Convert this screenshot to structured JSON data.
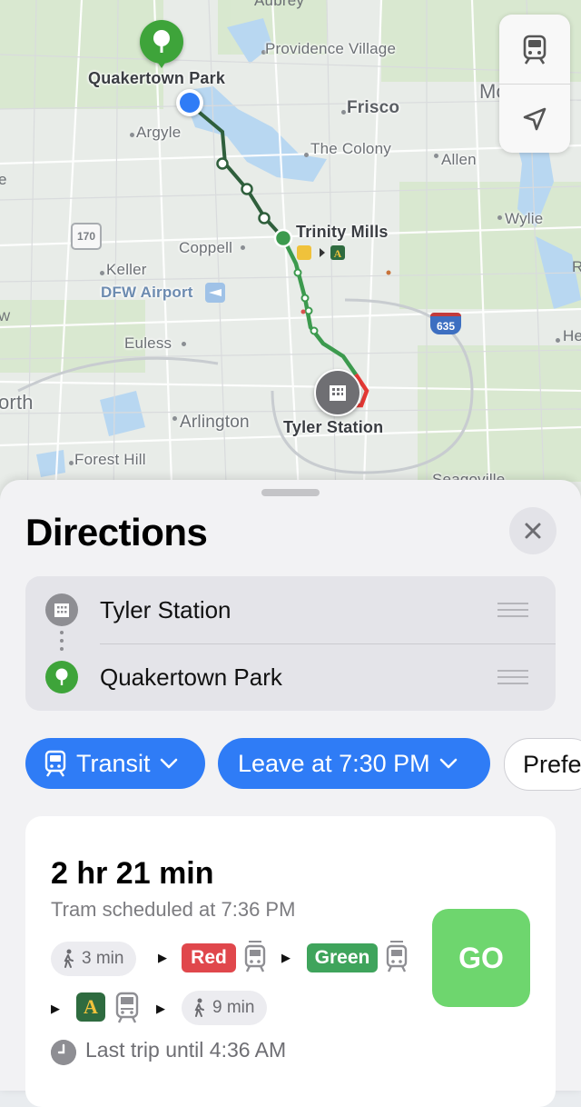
{
  "map": {
    "labels": {
      "aubrey": "Aubrey",
      "providence_village": "Providence Village",
      "quakertown_park": "Quakertown Park",
      "mckinney_partial": "Mc",
      "frisco": "Frisco",
      "argyle": "Argyle",
      "the_colony": "The Colony",
      "allen": "Allen",
      "edge_e": "e",
      "wylie": "Wylie",
      "trinity_mills": "Trinity Mills",
      "coppell": "Coppell",
      "keller": "Keller",
      "dfw_airport": "DFW Airport",
      "edge_r": "R",
      "edge_w": "W",
      "euless": "Euless",
      "edge_he": "He",
      "north_partial": "orth",
      "arlington": "Arlington",
      "tyler_station": "Tyler Station",
      "forest_hill": "Forest Hill",
      "seagoville": "Seagoville"
    },
    "highways": {
      "i170": "170",
      "i635": "635"
    },
    "controls": [
      "transit-mode-icon",
      "location-arrow-icon"
    ],
    "colors": {
      "red_line": "#e53935",
      "green_line": "#3c9a4e",
      "route_dark": "#2f5f3c",
      "user_dot": "#2f7cf6",
      "park_pin": "#3ea43a",
      "station_pin": "#6f6f73"
    }
  },
  "sheet": {
    "title": "Directions",
    "close_icon": "close-icon",
    "stops": [
      {
        "name": "Tyler Station",
        "icon": "building-icon"
      },
      {
        "name": "Quakertown Park",
        "icon": "tree-icon"
      }
    ],
    "chips": {
      "transit": "Transit",
      "leave": "Leave at 7:30 PM",
      "prefs": "Prefe"
    },
    "route": {
      "duration": "2 hr 21 min",
      "scheduled": "Tram scheduled at 7:36 PM",
      "walk_start": "3 min",
      "line_red": "Red",
      "line_green": "Green",
      "line_a": "A",
      "walk_end": "9 min",
      "go": "GO",
      "last_trip": "Last trip until 4:36 AM",
      "colors": {
        "red": "#e0474c",
        "green": "#3fa45c",
        "a_badge": "#2e6b3f"
      }
    }
  }
}
